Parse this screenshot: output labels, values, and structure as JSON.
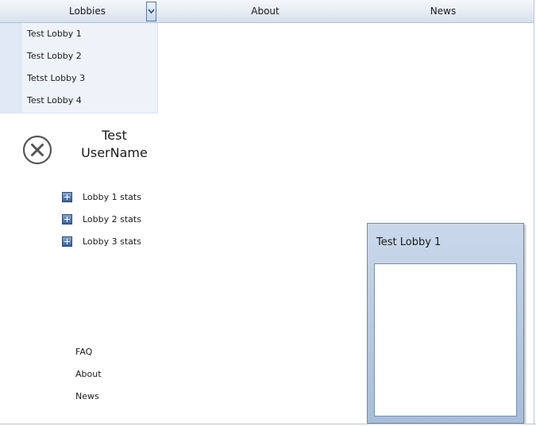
{
  "menubar": {
    "lobbies_label": "Lobbies",
    "about_label": "About",
    "news_label": "News"
  },
  "lobbies_dropdown": {
    "expanded": true,
    "items": [
      {
        "label": "Test Lobby 1"
      },
      {
        "label": "Test Lobby 2"
      },
      {
        "label": "Tetst Lobby 3"
      },
      {
        "label": "Test Lobby 4"
      }
    ]
  },
  "user": {
    "name_line1": "Test",
    "name_line2": "UserName",
    "close_icon": "close-circle-icon"
  },
  "stats": {
    "items": [
      {
        "label": "Lobby 1 stats",
        "icon": "expand-plus-icon"
      },
      {
        "label": "Lobby 2 stats",
        "icon": "expand-plus-icon"
      },
      {
        "label": "Lobby 3 stats",
        "icon": "expand-plus-icon"
      }
    ]
  },
  "footer": {
    "links": [
      {
        "label": "FAQ"
      },
      {
        "label": "About"
      },
      {
        "label": "News"
      }
    ]
  },
  "lobby_panel": {
    "title": "Test Lobby 1"
  },
  "colors": {
    "accent": "#3c5f93",
    "panel_bg": "#b6c8df",
    "menubar_bg": "#e7edf5"
  }
}
